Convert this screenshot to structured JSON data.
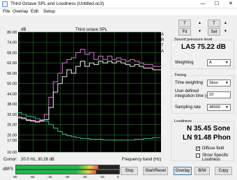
{
  "window": {
    "title": "Third Octave SPL and Loudness (Untitled.oc3)"
  },
  "window_controls": {
    "minimize": "—",
    "maximize": "☐",
    "close": "✕"
  },
  "menu": [
    "File",
    "Overlay",
    "Edit",
    "Setup"
  ],
  "toolbar": {
    "t_left": "T",
    "t_right": "T",
    "fit_left": "Fit",
    "set_right": "Set"
  },
  "side_letters": [
    "A",
    "R",
    "T",
    "A"
  ],
  "spl_panel": {
    "title": "Sound pressure level",
    "value": "LAS 75.22 dB",
    "weighting_label": "Weighting",
    "weighting_value": "A"
  },
  "timing_panel": {
    "title": "Timing",
    "time_weighting_label": "Time weighting",
    "time_weighting_value": "Slow",
    "integration_label_1": "User defined",
    "integration_label_2": "integration time (s)",
    "integration_value": "10",
    "sampling_label": "Sampling rate",
    "sampling_value": "48000"
  },
  "loudness_panel": {
    "title": "Loudness",
    "sone": "N 35.45 Sone",
    "phon": "LN 91.48 Phon",
    "diffuse_label": "Diffuse field",
    "diffuse_checked": true,
    "specific_label": "Show Specific Loudness",
    "specific_checked": false
  },
  "cursor_readout": {
    "label": "Cursor:",
    "value": "20.0 Hz, 30.26 dB",
    "axis_label": "Frequency band (Hz)"
  },
  "meter": {
    "label": "dBFS",
    "ticks": [
      "-60",
      "-50",
      "-40",
      "-30",
      "-20",
      "-10",
      "0"
    ],
    "level": 0.8
  },
  "bottom_buttons": {
    "stop": "Stop",
    "start_reset": "Start/Reset",
    "overlay": "Overlay",
    "bw": "B/W",
    "copy": "Copy"
  },
  "colors": {
    "pink": "#e070d8",
    "white": "#f0f0f0",
    "green": "#2fbf7f",
    "grid": "#2f6f2f"
  },
  "chart_data": {
    "type": "line",
    "title": "Third octave SPL",
    "ylabel": "dB",
    "xlabel": "Frequency band (Hz)",
    "ylim": [
      10,
      80
    ],
    "ytick_labels": [
      "80.00",
      "74.00",
      "68.00",
      "62.00",
      "56.00",
      "50.00",
      "44.00",
      "38.00",
      "32.00",
      "26.00",
      "20.00",
      "17.00",
      "10.00"
    ],
    "yticks": [
      80,
      74,
      68,
      62,
      56,
      50,
      44,
      38,
      32,
      26,
      20,
      17,
      10
    ],
    "categories": [
      "16",
      "20",
      "25",
      "32",
      "40",
      "50",
      "63",
      "80",
      "100",
      "125",
      "160",
      "200",
      "250",
      "315",
      "400",
      "500",
      "630",
      "800",
      "1k",
      "1.25k",
      "1.6k",
      "2k",
      "2.5k",
      "3.15k",
      "4k",
      "5k",
      "6.3k",
      "8k",
      "10k",
      "12.5k",
      "16k",
      "20k"
    ],
    "xtick_labels": [
      "16",
      "32",
      "63",
      "125",
      "250",
      "500",
      "1k",
      "2k",
      "4k",
      "8k",
      "16k"
    ],
    "grid": true,
    "series": [
      {
        "values": [
          30.5,
          30,
          29,
          28.5,
          28,
          28.5,
          32,
          42,
          51,
          56,
          62,
          64,
          65,
          68,
          70,
          67,
          68,
          64,
          66,
          64,
          66,
          64,
          65,
          64,
          63,
          64,
          63,
          62,
          61,
          61,
          60,
          60
        ]
      },
      {
        "values": [
          30,
          29.5,
          28.5,
          28,
          27.5,
          28,
          29,
          36,
          45,
          50,
          54,
          58,
          56,
          60,
          63,
          60,
          62,
          61,
          63,
          62,
          63,
          62,
          63,
          62,
          61,
          60,
          61,
          60,
          59,
          59,
          58,
          58
        ]
      },
      {
        "values": [
          33,
          32,
          31,
          30.5,
          29.5,
          29,
          28,
          26,
          24,
          22,
          20.5,
          19.5,
          19,
          18.5,
          18,
          18,
          17.5,
          17.5,
          17.5,
          17,
          17,
          17,
          17,
          17,
          17,
          17,
          17.5,
          17.5,
          18,
          18,
          18.5,
          18.5
        ]
      }
    ]
  }
}
